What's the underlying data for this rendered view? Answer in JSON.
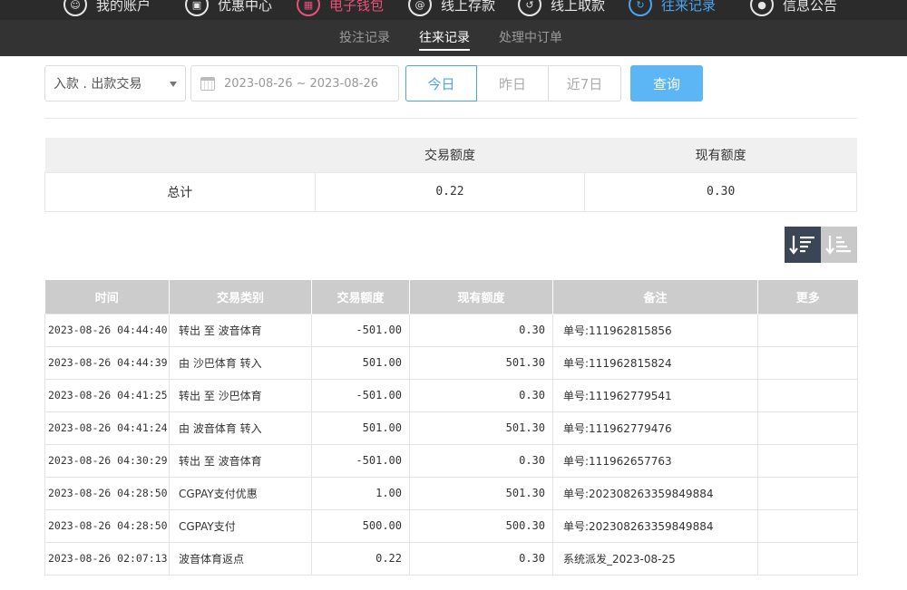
{
  "topnav": {
    "items": [
      {
        "label": "我的账户",
        "icon": "user-icon"
      },
      {
        "label": "优惠中心",
        "icon": "gift-icon"
      },
      {
        "label": "电子钱包",
        "icon": "wallet-icon"
      },
      {
        "label": "线上存款",
        "icon": "deposit-icon"
      },
      {
        "label": "线上取款",
        "icon": "withdraw-icon"
      },
      {
        "label": "往来记录",
        "icon": "records-icon"
      },
      {
        "label": "信息公告",
        "icon": "announcement-icon"
      }
    ]
  },
  "subnav": {
    "tabs": [
      {
        "label": "投注记录"
      },
      {
        "label": "往来记录"
      },
      {
        "label": "处理中订单"
      }
    ]
  },
  "filters": {
    "type_select": "入款 . 出款交易",
    "date_start": "2023-08-26",
    "date_sep": "~",
    "date_end": "2023-08-26",
    "today": "今日",
    "yesterday": "昨日",
    "last7": "近7日",
    "query": "查询"
  },
  "summary": {
    "col_amount": "交易额度",
    "col_balance": "现有额度",
    "row_label": "总计",
    "amount": "0.22",
    "balance": "0.30"
  },
  "table": {
    "headers": [
      "时间",
      "交易类别",
      "交易额度",
      "现有额度",
      "备注",
      "更多"
    ],
    "rows": [
      [
        "2023-08-26 04:44:40",
        "转出 至 波音体育",
        "-501.00",
        "0.30",
        "单号:111962815856",
        ""
      ],
      [
        "2023-08-26 04:44:39",
        "由 沙巴体育 转入",
        "501.00",
        "501.30",
        "单号:111962815824",
        ""
      ],
      [
        "2023-08-26 04:41:25",
        "转出 至 沙巴体育",
        "-501.00",
        "0.30",
        "单号:111962779541",
        ""
      ],
      [
        "2023-08-26 04:41:24",
        "由 波音体育 转入",
        "501.00",
        "501.30",
        "单号:111962779476",
        ""
      ],
      [
        "2023-08-26 04:30:29",
        "转出 至 波音体育",
        "-501.00",
        "0.30",
        "单号:111962657763",
        ""
      ],
      [
        "2023-08-26 04:28:50",
        "CGPAY支付优惠",
        "1.00",
        "501.30",
        "单号:202308263359849884",
        ""
      ],
      [
        "2023-08-26 04:28:50",
        "CGPAY支付",
        "500.00",
        "500.30",
        "单号:202308263359849884",
        ""
      ],
      [
        "2023-08-26 02:07:13",
        "波音体育返点",
        "0.22",
        "0.30",
        "系统派发_2023-08-25",
        ""
      ]
    ]
  }
}
